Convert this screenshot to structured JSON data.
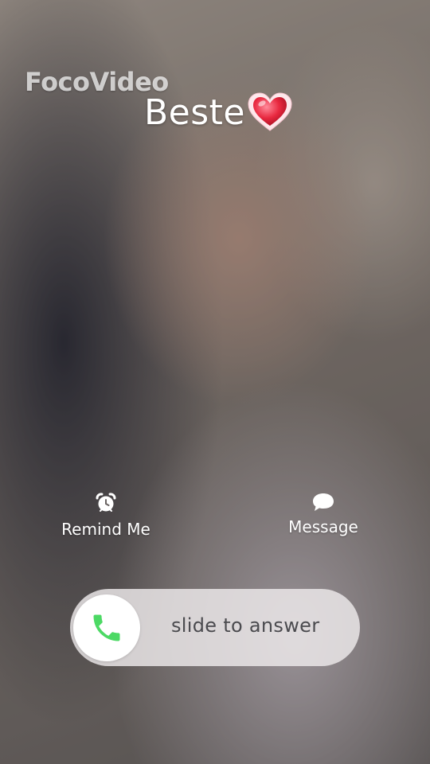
{
  "watermark": {
    "text": "FocoVideo"
  },
  "caller": {
    "name": "Beste",
    "emoji_icon": "heart-emoji-icon"
  },
  "actions": {
    "remind": {
      "label": "Remind Me",
      "icon": "alarm-clock-icon"
    },
    "message": {
      "label": "Message",
      "icon": "speech-bubble-icon"
    }
  },
  "answer_slider": {
    "hint": "slide to answer",
    "knob_icon": "phone-icon",
    "phone_color": "#4cd964"
  }
}
